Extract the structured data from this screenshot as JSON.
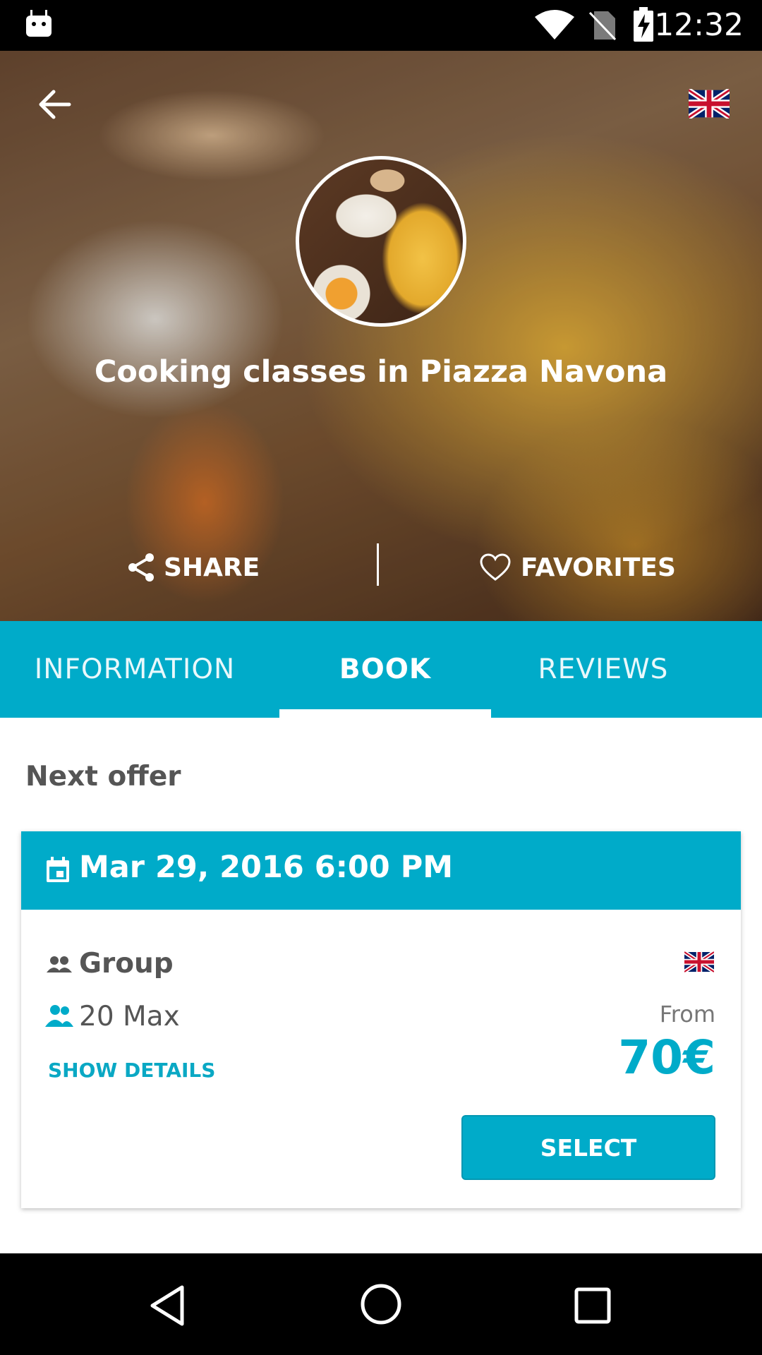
{
  "status_bar": {
    "time": "12:32"
  },
  "hero": {
    "title": "Cooking classes in Piazza Navona",
    "share_label": "SHARE",
    "favorites_label": "FAVORITES"
  },
  "tabs": [
    {
      "label": "INFORMATION"
    },
    {
      "label": "BOOK"
    },
    {
      "label": "REVIEWS"
    }
  ],
  "content": {
    "section_title": "Next offer",
    "offer": {
      "date": "Mar 29, 2016 6:00 PM",
      "type": "Group",
      "capacity": "20 Max",
      "show_details": "SHOW DETAILS",
      "from_label": "From",
      "price": "70€",
      "select_label": "SELECT"
    }
  },
  "colors": {
    "accent": "#00abc9",
    "text_dark": "#555555"
  }
}
